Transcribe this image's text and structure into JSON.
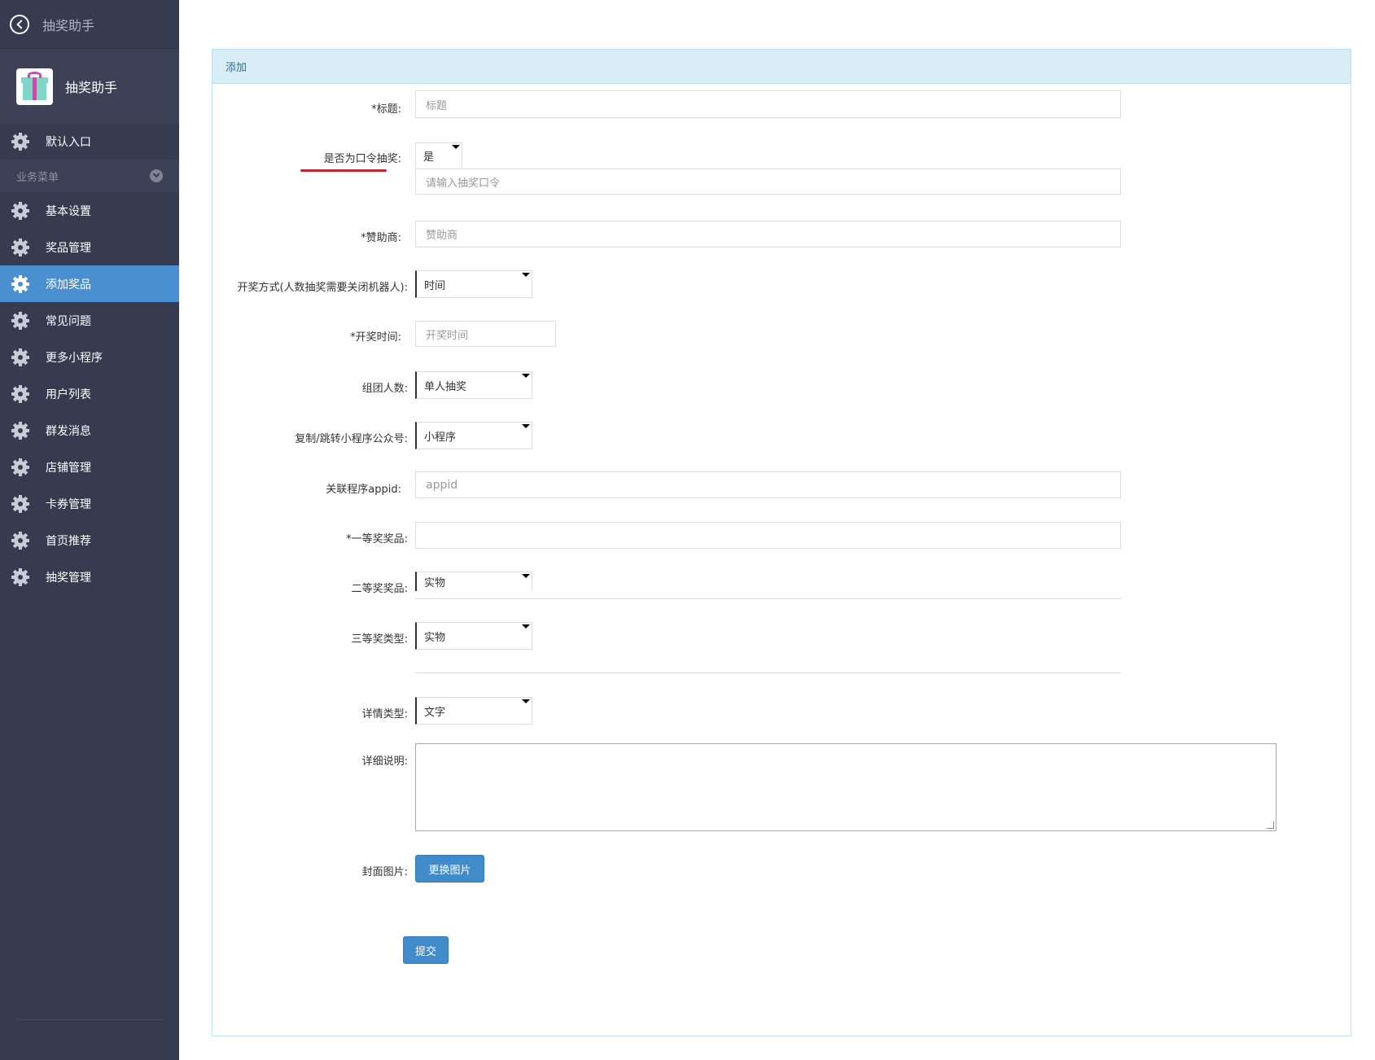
{
  "sidebar": {
    "top_title": "抽奖助手",
    "brand_name": "抽奖助手",
    "default_entry": "默认入口",
    "group_label": "业务菜单",
    "items": [
      {
        "label": "基本设置"
      },
      {
        "label": "奖品管理"
      },
      {
        "label": "添加奖品"
      },
      {
        "label": "常见问题"
      },
      {
        "label": "更多小程序"
      },
      {
        "label": "用户列表"
      },
      {
        "label": "群发消息"
      },
      {
        "label": "店铺管理"
      },
      {
        "label": "卡券管理"
      },
      {
        "label": "首页推荐"
      },
      {
        "label": "抽奖管理"
      }
    ],
    "active_item": "添加奖品"
  },
  "panel": {
    "title": "添加"
  },
  "form": {
    "title_label": "*标题:",
    "title_placeholder": "标题",
    "password_label": "是否为口令抽奖:",
    "password_select": "是",
    "password_placeholder": "请输入抽奖口令",
    "sponsor_label": "*赞助商:",
    "sponsor_placeholder": "赞助商",
    "draw_mode_label": "开奖方式(人数抽奖需要关闭机器人):",
    "draw_mode_select": "时间",
    "draw_time_label": "*开奖时间:",
    "draw_time_placeholder": "开奖时间",
    "group_label": "组团人数:",
    "group_select": "单人抽奖",
    "copy_jump_label": "复制/跳转小程序公众号:",
    "copy_jump_select": "小程序",
    "appid_label": "关联程序appid:",
    "appid_placeholder": "appid",
    "first_prize_label": "*一等奖奖品:",
    "second_prize_label": "二等奖奖品:",
    "second_prize_select": "实物",
    "third_prize_label": "三等奖类型:",
    "third_prize_select": "实物",
    "detail_type_label": "详情类型:",
    "detail_type_select": "文字",
    "detail_desc_label": "详细说明:",
    "cover_label": "封面图片:",
    "change_image_button": "更换图片",
    "submit_button": "提交"
  },
  "colors": {
    "sidebar_bg": "#363b4f",
    "active_bg": "#4a8fd0",
    "panel_head_bg": "#d9edf7",
    "button_bg": "#428bca",
    "underline": "#c0262e"
  }
}
